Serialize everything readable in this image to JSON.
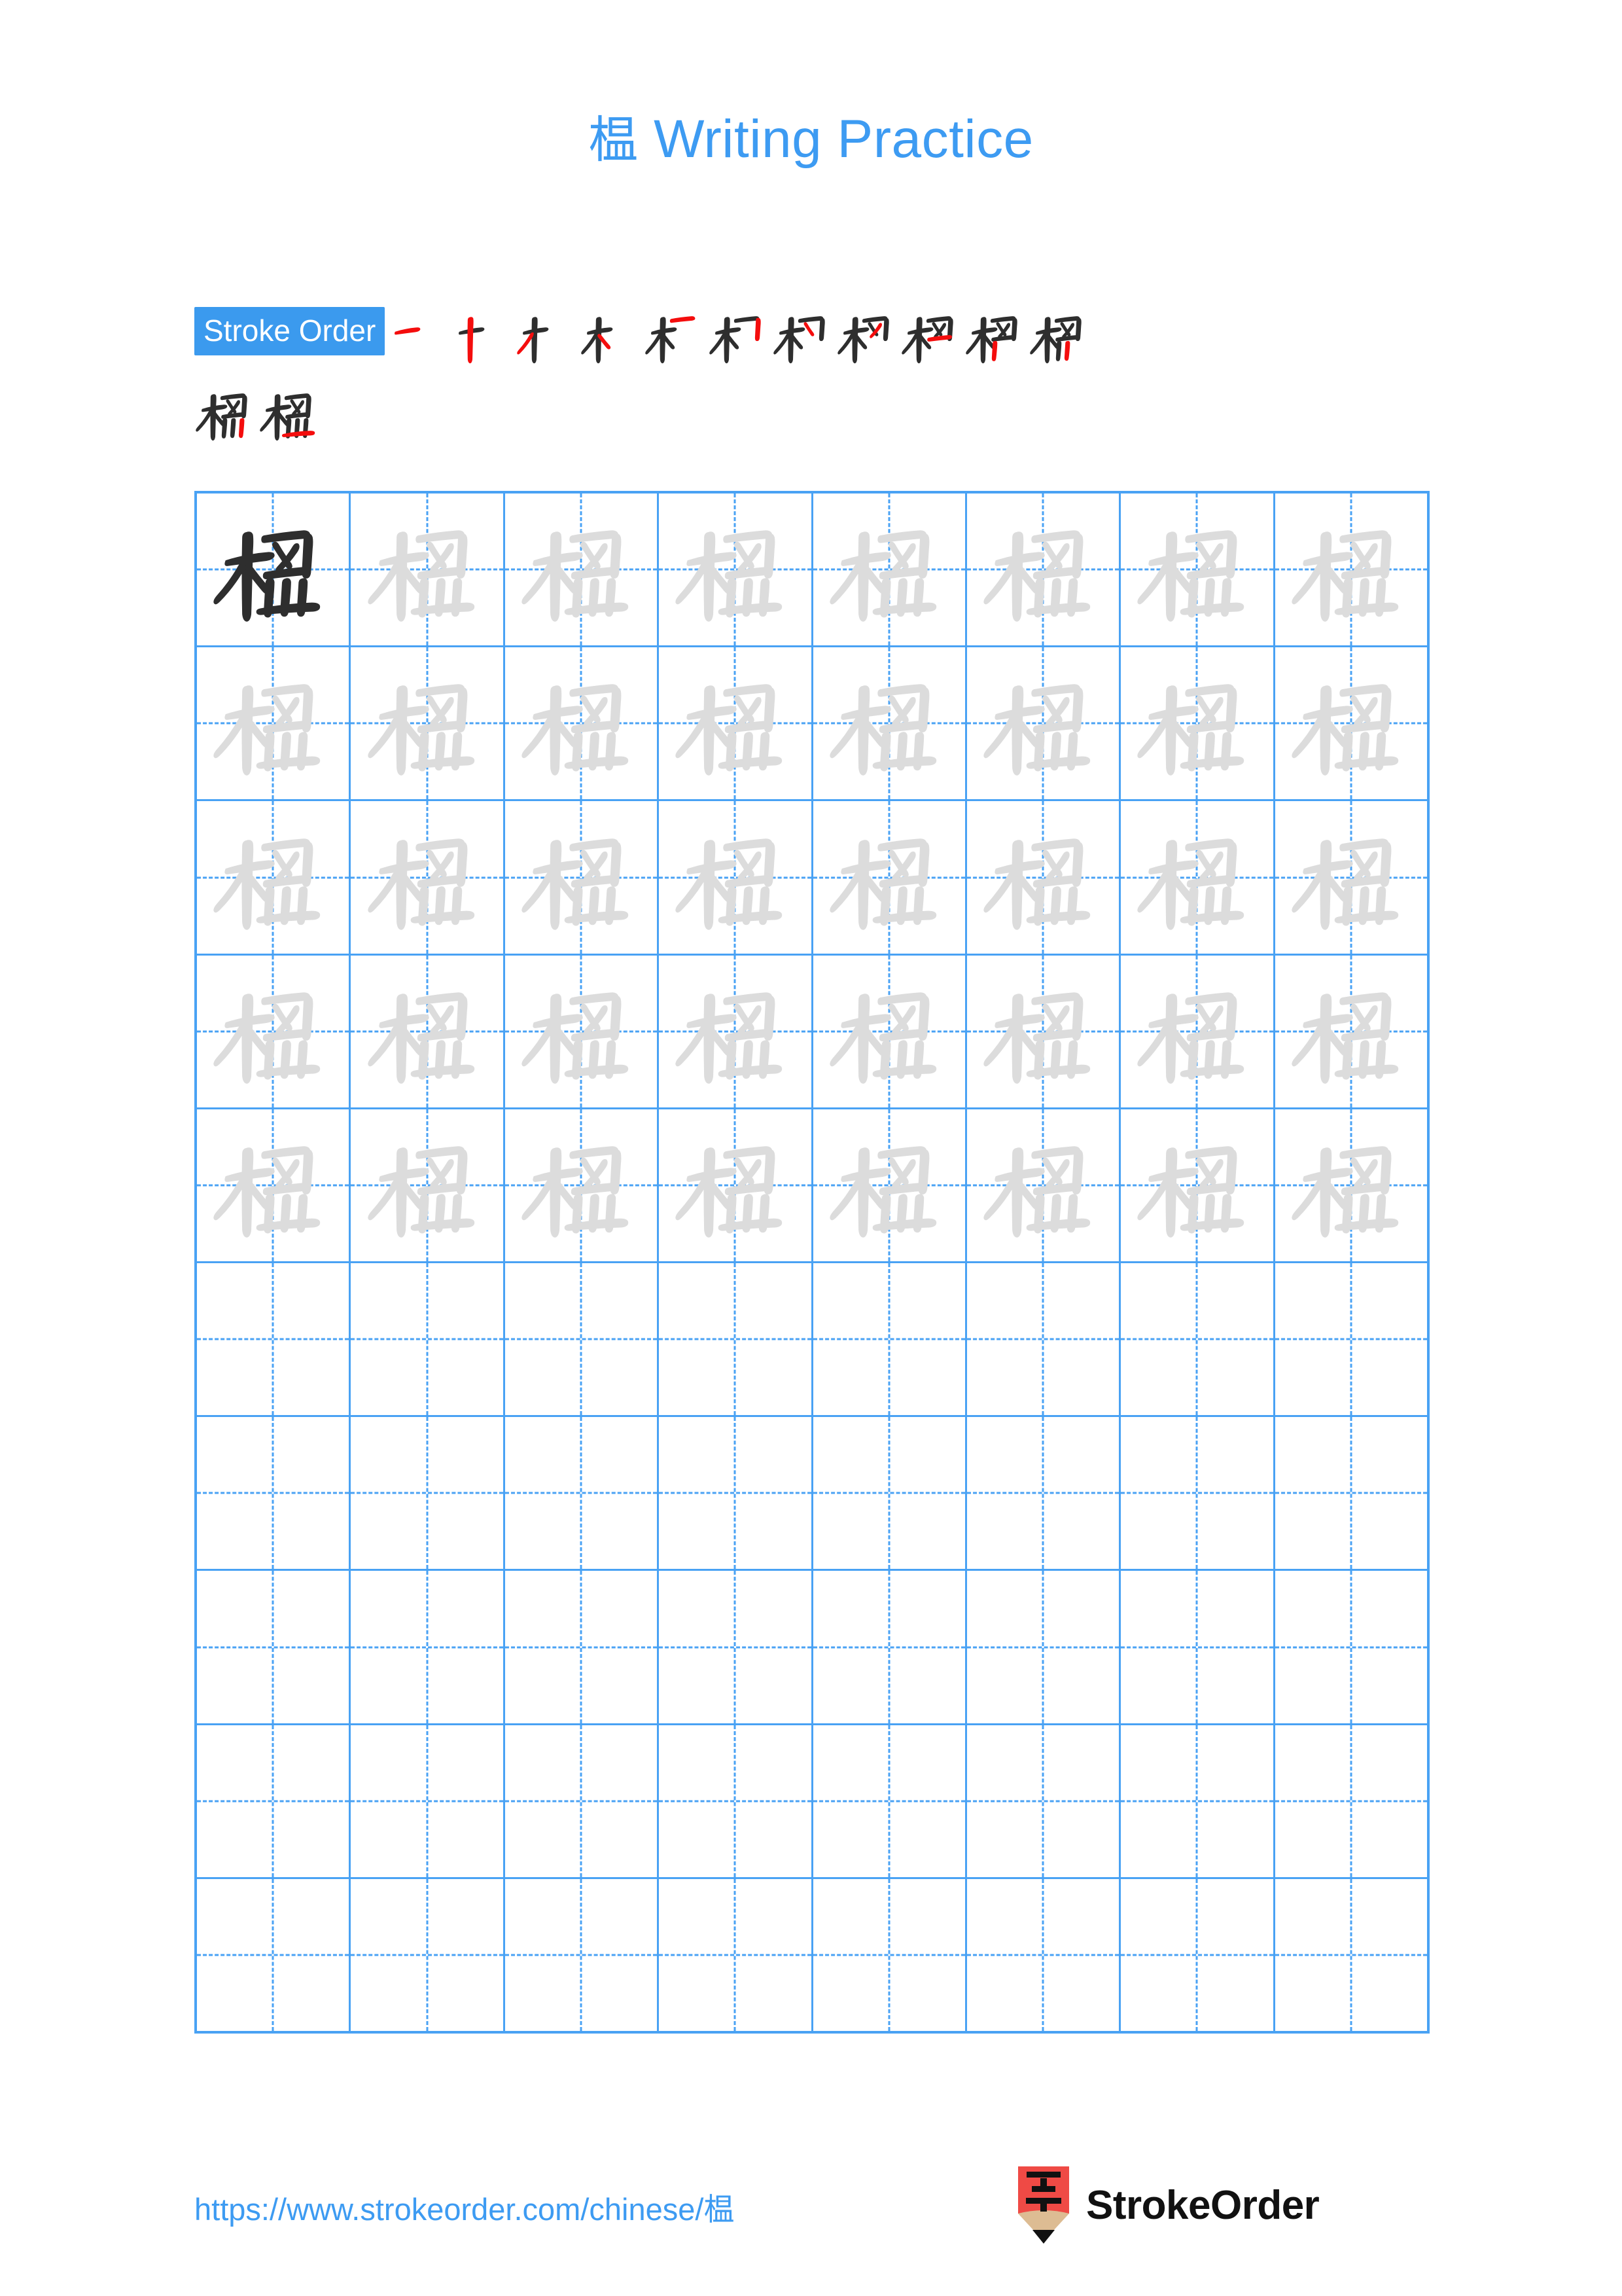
{
  "page": {
    "character": "榅",
    "title_suffix": "Writing Practice",
    "background_color": "#ffffff",
    "accent_color": "#3d9bf2",
    "grid_line_color": "#49a2f4",
    "trace_color": "#dcdcdc",
    "model_color": "#2e2e2e",
    "new_stroke_color": "#f40d0d"
  },
  "title": {
    "character": "榅",
    "text": "Writing Practice",
    "full": "榅 Writing Practice"
  },
  "stroke_order": {
    "badge_label": "Stroke Order",
    "badge_bg": "#3b9aee",
    "badge_text_color": "#ffffff",
    "total_strokes": 13,
    "rows": [
      {
        "steps": [
          1,
          2,
          3,
          4,
          5,
          6,
          7,
          8,
          9,
          10,
          11
        ]
      },
      {
        "steps": [
          12,
          13
        ]
      }
    ],
    "step_labels": [
      "stroke-1",
      "stroke-2",
      "stroke-3",
      "stroke-4",
      "stroke-5",
      "stroke-6",
      "stroke-7",
      "stroke-8",
      "stroke-9",
      "stroke-10",
      "stroke-11",
      "stroke-12",
      "stroke-13"
    ]
  },
  "practice_grid": {
    "columns": 8,
    "rows": 10,
    "filled_rows": 5,
    "empty_rows": 5,
    "character": "榅",
    "cells": [
      [
        "dark",
        "light",
        "light",
        "light",
        "light",
        "light",
        "light",
        "light"
      ],
      [
        "light",
        "light",
        "light",
        "light",
        "light",
        "light",
        "light",
        "light"
      ],
      [
        "light",
        "light",
        "light",
        "light",
        "light",
        "light",
        "light",
        "light"
      ],
      [
        "light",
        "light",
        "light",
        "light",
        "light",
        "light",
        "light",
        "light"
      ],
      [
        "light",
        "light",
        "light",
        "light",
        "light",
        "light",
        "light",
        "light"
      ],
      [
        "empty",
        "empty",
        "empty",
        "empty",
        "empty",
        "empty",
        "empty",
        "empty"
      ],
      [
        "empty",
        "empty",
        "empty",
        "empty",
        "empty",
        "empty",
        "empty",
        "empty"
      ],
      [
        "empty",
        "empty",
        "empty",
        "empty",
        "empty",
        "empty",
        "empty",
        "empty"
      ],
      [
        "empty",
        "empty",
        "empty",
        "empty",
        "empty",
        "empty",
        "empty",
        "empty"
      ],
      [
        "empty",
        "empty",
        "empty",
        "empty",
        "empty",
        "empty",
        "empty",
        "empty"
      ]
    ]
  },
  "footer": {
    "url": "https://www.strokeorder.com/chinese/榅",
    "brand_name": "StrokeOrder",
    "logo_icon": "pencil-zi-icon",
    "logo_char": "字",
    "logo_body_color": "#ef4a45",
    "logo_tip_color": "#ddbc93",
    "logo_point_color": "#111111"
  }
}
